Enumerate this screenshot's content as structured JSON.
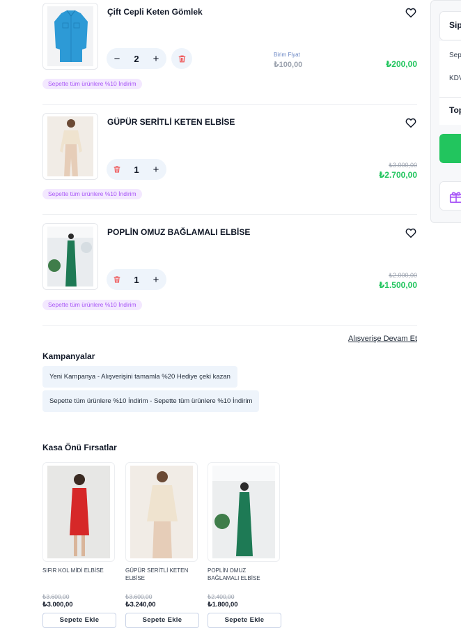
{
  "cart": {
    "items": [
      {
        "title": "Çift Cepli Keten Gömlek",
        "quantity": "2",
        "unit_price_label": "Birim Fiyat",
        "unit_price": "₺100,00",
        "price": "₺200,00",
        "promo": "Sepette tüm ürünlere %10 İndirim"
      },
      {
        "title": "GÜPÜR SERİTLİ KETEN ELBİSE",
        "quantity": "1",
        "old_price": "₺3.000,00",
        "price": "₺2.700,00",
        "promo": "Sepette tüm ürünlere %10 İndirim"
      },
      {
        "title": "POPLİN OMUZ BAĞLAMALI ELBİSE",
        "quantity": "1",
        "old_price": "₺2.000,00",
        "price": "₺1.500,00",
        "promo": "Sepette tüm ürünlere %10 İndirim"
      }
    ],
    "continue_shopping": "Alışverişe Devam Et"
  },
  "campaigns": {
    "title": "Kampanyalar",
    "items": [
      "Yeni Kampanya - Alışverişini tamamla %20 Hediye çeki kazan",
      "Sepette tüm ürünlere %10 İndirim - Sepette tüm ürünlere %10 İndirim"
    ]
  },
  "checkout_deals": {
    "title": "Kasa Önü Fırsatlar",
    "add_label": "Sepete Ekle",
    "products": [
      {
        "name": "SIFIR KOL MİDİ ELBİSE",
        "old_price": "₺3.600,00",
        "price": "₺3.000,00"
      },
      {
        "name": "GÜPÜR SERİTLİ KETEN ELBİSE",
        "old_price": "₺3.600,00",
        "price": "₺3.240,00"
      },
      {
        "name": "POPLİN OMUZ BAĞLAMALI ELBİSE",
        "old_price": "₺2.400,00",
        "price": "₺1.800,00"
      }
    ]
  },
  "summary": {
    "title": "Sip",
    "line1": "Sep",
    "line2": "KDV",
    "total": "Top"
  },
  "colors": {
    "accent_green": "#22c55e",
    "promo_purple": "#a855f7",
    "delete_red": "#ef4444",
    "qty_bg": "#eef4fb"
  }
}
